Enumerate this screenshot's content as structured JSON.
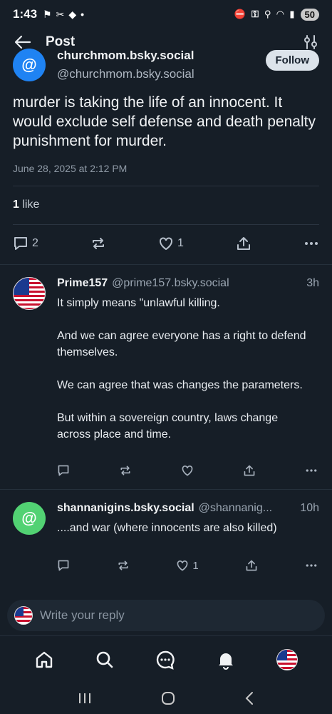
{
  "status_bar": {
    "time": "1:43",
    "battery": "50"
  },
  "topbar": {
    "title": "Post"
  },
  "main_post": {
    "display_name": "churchmom.bsky.social",
    "handle": "@churchmom.bsky.social",
    "follow_label": "Follow",
    "avatar_glyph": "@",
    "text": "murder is taking the life of an innocent. It would exclude  self defense and death penalty punishment for murder.",
    "date": "June 28, 2025 at 2:12 PM",
    "likes_count": "1",
    "likes_label": "like",
    "reply_count": "2",
    "like_count": "1"
  },
  "replies": [
    {
      "name": "Prime157",
      "handle": "@prime157.bsky.social",
      "time": "3h",
      "paragraphs": [
        "It simply means \"unlawful killing.",
        "And we can agree everyone has a right to defend themselves.",
        "We can agree that was changes the parameters.",
        "But within a sovereign country, laws change across place and time."
      ],
      "like_count": ""
    },
    {
      "name": "shannanigins.bsky.social",
      "handle": "@shannanig...",
      "time": "10h",
      "avatar_glyph": "@",
      "paragraphs": [
        "....and war (where innocents are also killed)"
      ],
      "like_count": "1"
    }
  ],
  "reply_bar": {
    "placeholder": "Write your reply"
  },
  "colors": {
    "background": "#161e27",
    "accent_blue": "#1f83f3",
    "avatar_green": "#52d273"
  }
}
